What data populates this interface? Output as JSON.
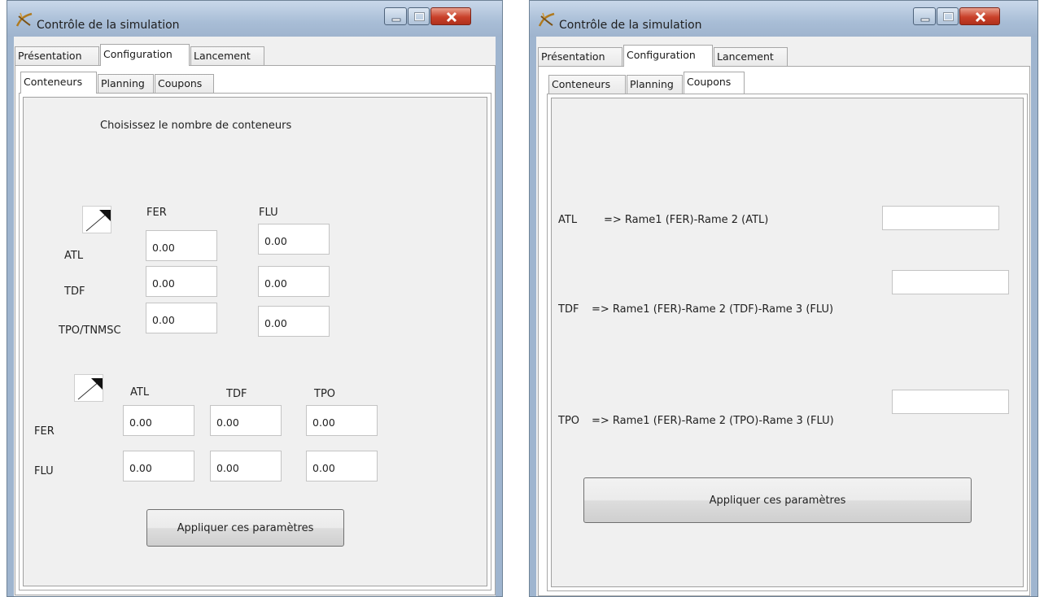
{
  "left_window": {
    "title": "Contrôle de la simulation",
    "main_tabs": [
      "Présentation",
      "Configuration",
      "Lancement"
    ],
    "active_main_tab": "Configuration",
    "sub_tabs": [
      "Conteneurs",
      "Planning",
      "Coupons"
    ],
    "active_sub_tab": "Conteneurs",
    "heading": "Choisissez le nombre de conteneurs",
    "grid1": {
      "col_headers": [
        "FER",
        "FLU"
      ],
      "rows": [
        {
          "label": "ATL",
          "values": [
            "0.00",
            "0.00"
          ]
        },
        {
          "label": "TDF",
          "values": [
            "0.00",
            "0.00"
          ]
        },
        {
          "label": "TPO/TNMSC",
          "values": [
            "0.00",
            "0.00"
          ]
        }
      ]
    },
    "grid2": {
      "col_headers": [
        "ATL",
        "TDF",
        "TPO"
      ],
      "rows": [
        {
          "label": "FER",
          "values": [
            "0.00",
            "0.00",
            "0.00"
          ]
        },
        {
          "label": "FLU",
          "values": [
            "0.00",
            "0.00",
            "0.00"
          ]
        }
      ]
    },
    "apply_button": "Appliquer ces paramètres"
  },
  "right_window": {
    "title": "Contrôle de la simulation",
    "main_tabs": [
      "Présentation",
      "Configuration",
      "Lancement"
    ],
    "active_main_tab": "Configuration",
    "sub_tabs": [
      "Conteneurs",
      "Planning",
      "Coupons"
    ],
    "active_sub_tab": "Coupons",
    "coupons": [
      {
        "code": "ATL",
        "route": "=> Rame1 (FER)-Rame 2 (ATL)",
        "value": ""
      },
      {
        "code": "TDF",
        "route": "=> Rame1 (FER)-Rame 2 (TDF)-Rame 3 (FLU)",
        "value": ""
      },
      {
        "code": "TPO",
        "route": "=> Rame1 (FER)-Rame 2 (TPO)-Rame 3 (FLU)",
        "value": ""
      }
    ],
    "apply_button": "Appliquer ces paramètres"
  },
  "colors": {
    "window_frame": "#9fb5cf",
    "client_bg": "#f0f0f0",
    "close_button": "#c9412a"
  }
}
